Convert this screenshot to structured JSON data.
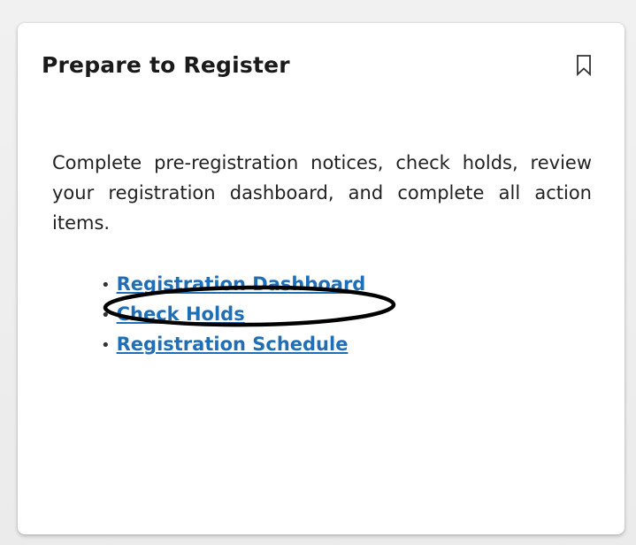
{
  "card": {
    "title": "Prepare to Register",
    "description": "Complete pre-registration notices, check holds, review your registration dashboard, and complete all action items.",
    "bullet": "•",
    "links": [
      {
        "label": "Registration Dashboard"
      },
      {
        "label": "Check Holds"
      },
      {
        "label": "Registration Schedule"
      }
    ]
  },
  "icons": {
    "bookmark": "bookmark-icon"
  },
  "colors": {
    "link": "#1f6fb8",
    "annotation": "#000000"
  },
  "annotation": {
    "shape": "ellipse",
    "target": "Registration Dashboard"
  }
}
